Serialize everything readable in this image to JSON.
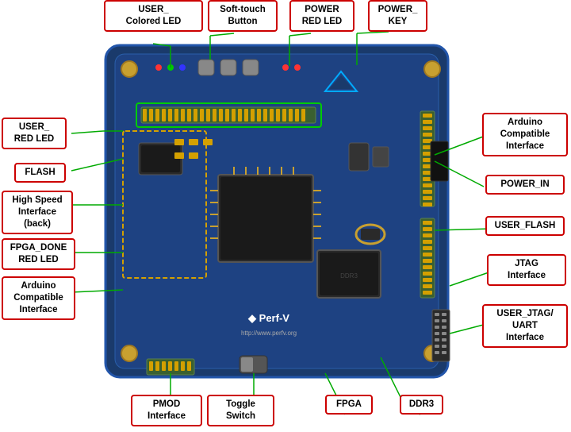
{
  "labels": {
    "user_colored_led": "USER_\nColored LED",
    "soft_touch_button": "Soft-touch\nButton",
    "power_red_led": "POWER\nRED LED",
    "power_key": "POWER_\nKEY",
    "user_red_led": "USER_\nRED LED",
    "flash": "FLASH",
    "high_speed_interface": "High Speed\nInterface\n(back)",
    "fpga_done_red_led": "FPGA_DONE\nRED LED",
    "arduino_compatible_left": "Arduino\nCompatible\nInterface",
    "pmod_interface": "PMOD\nInterface",
    "toggle_switch": "Toggle\nSwitch",
    "fpga": "FPGA",
    "ddr3": "DDR3",
    "arduino_compatible_right": "Arduino\nCompatible\nInterface",
    "power_in": "POWER_IN",
    "user_flash": "USER_FLASH",
    "jtag_interface": "JTAG\nInterface",
    "user_jtag_uart": "USER_JTAG/\nUART\nInterface",
    "brand": "Perf-V",
    "url": "http://www.perfv.org"
  },
  "colors": {
    "label_border": "#cc0000",
    "line_color": "#00aa00",
    "pcb_bg": "#1a3a6b",
    "text_color": "#000000",
    "brand_color": "#ffffff"
  }
}
